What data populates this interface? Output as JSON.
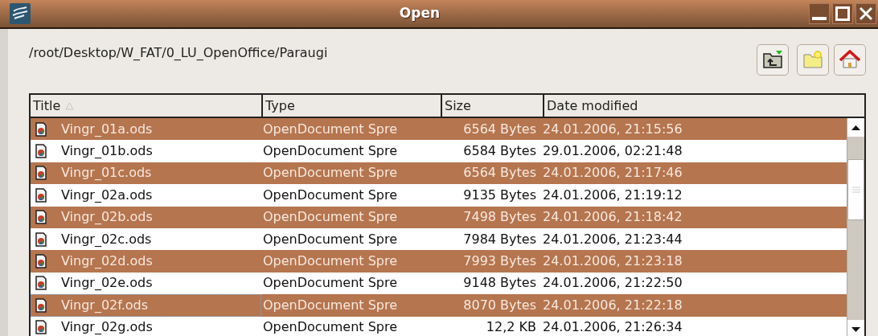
{
  "window": {
    "title": "Open"
  },
  "path": "/root/Desktop/W_FAT/0_LU_OpenOffice/Paraugi",
  "table": {
    "columns": [
      {
        "label": "Title",
        "sorted": true
      },
      {
        "label": "Type",
        "sorted": false
      },
      {
        "label": "Size",
        "sorted": false
      },
      {
        "label": "Date modified",
        "sorted": false
      }
    ],
    "rows": [
      {
        "title": "Vingr_01a.ods",
        "type": "OpenDocument Spre",
        "size": "6564 Bytes",
        "date": "24.01.2006, 21:15:56",
        "selected": true,
        "focused": false
      },
      {
        "title": "Vingr_01b.ods",
        "type": "OpenDocument Spre",
        "size": "6584 Bytes",
        "date": "29.01.2006, 02:21:48",
        "selected": false,
        "focused": false
      },
      {
        "title": "Vingr_01c.ods",
        "type": "OpenDocument Spre",
        "size": "6564 Bytes",
        "date": "24.01.2006, 21:17:46",
        "selected": true,
        "focused": false
      },
      {
        "title": "Vingr_02a.ods",
        "type": "OpenDocument Spre",
        "size": "9135 Bytes",
        "date": "24.01.2006, 21:19:12",
        "selected": false,
        "focused": false
      },
      {
        "title": "Vingr_02b.ods",
        "type": "OpenDocument Spre",
        "size": "7498 Bytes",
        "date": "24.01.2006, 21:18:42",
        "selected": true,
        "focused": false
      },
      {
        "title": "Vingr_02c.ods",
        "type": "OpenDocument Spre",
        "size": "7984 Bytes",
        "date": "24.01.2006, 21:23:44",
        "selected": false,
        "focused": false
      },
      {
        "title": "Vingr_02d.ods",
        "type": "OpenDocument Spre",
        "size": "7993 Bytes",
        "date": "24.01.2006, 21:23:18",
        "selected": true,
        "focused": false
      },
      {
        "title": "Vingr_02e.ods",
        "type": "OpenDocument Spre",
        "size": "9148 Bytes",
        "date": "24.01.2006, 21:22:50",
        "selected": false,
        "focused": false
      },
      {
        "title": "Vingr_02f.ods",
        "type": "OpenDocument Spre",
        "size": "8070 Bytes",
        "date": "24.01.2006, 21:22:18",
        "selected": true,
        "focused": true
      },
      {
        "title": "Vingr_02g.ods",
        "type": "OpenDocument Spre",
        "size": "12,2 KB",
        "date": "24.01.2006, 21:26:34",
        "selected": false,
        "focused": false
      }
    ]
  }
}
